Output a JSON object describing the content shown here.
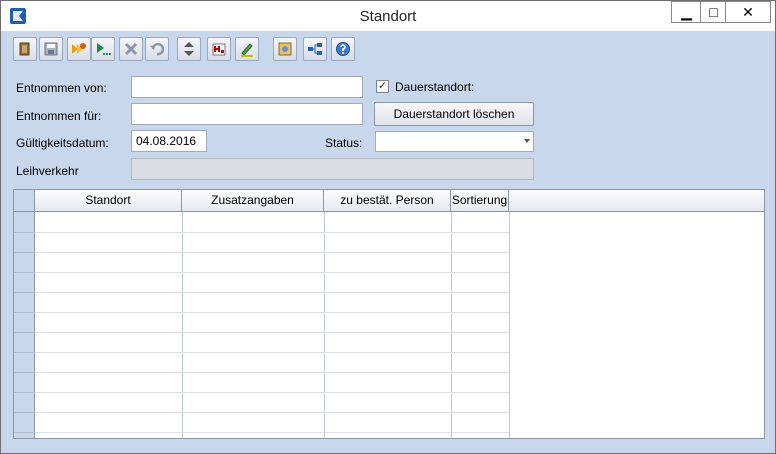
{
  "window": {
    "title": "Standort"
  },
  "titlebar_buttons": {
    "minimize": "▁",
    "maximize": "□",
    "close": "✕"
  },
  "toolbar": {
    "items": [
      {
        "name": "exit-icon"
      },
      {
        "name": "save-icon"
      },
      {
        "name": "new-record-icon"
      },
      {
        "name": "run-icon"
      },
      {
        "name": "delete-icon"
      },
      {
        "name": "undo-icon"
      },
      {
        "name": "up-down-icon"
      },
      {
        "name": "h-report-icon"
      },
      {
        "name": "edit-pen-icon"
      },
      {
        "name": "map-icon"
      },
      {
        "name": "hierarchy-icon"
      },
      {
        "name": "help-icon"
      }
    ]
  },
  "form": {
    "entnommen_von_label": "Entnommen von:",
    "entnommen_von_value": "",
    "entnommen_fuer_label": "Entnommen für:",
    "entnommen_fuer_value": "",
    "gueltigkeitsdatum_label": "Gültigkeitsdatum:",
    "gueltigkeitsdatum_value": "04.08.2016",
    "leihverkehr_label": "Leihverkehr",
    "dauerstandort_label": "Dauerstandort:",
    "dauerstandort_checked": "✓",
    "dauerstandort_loeschen_label": "Dauerstandort löschen",
    "status_label": "Status:",
    "status_value": ""
  },
  "grid": {
    "columns": [
      "Standort",
      "Zusatzangaben",
      "zu bestät. Person",
      "Sortierung"
    ],
    "rows": []
  },
  "colors": {
    "panel": "#c9d7ec",
    "accent": "#1f5fa8"
  }
}
